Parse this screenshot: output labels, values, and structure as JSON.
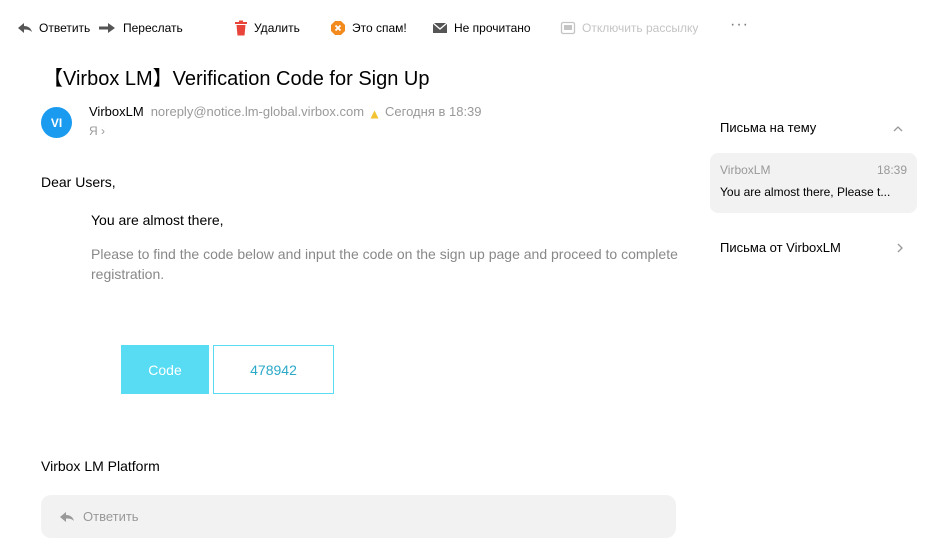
{
  "toolbar": {
    "reply": "Ответить",
    "forward": "Переслать",
    "delete": "Удалить",
    "spam": "Это спам!",
    "unread": "Не прочитано",
    "unsubscribe": "Отключить рассылку",
    "more": "···"
  },
  "email": {
    "subject": "【Virbox LM】Verification Code for Sign Up",
    "avatar_initials": "VI",
    "sender_name": "VirboxLM",
    "sender_email": "noreply@notice.lm-global.virbox.com",
    "date": "Сегодня в 18:39",
    "recipient": "Я ›",
    "greeting": "Dear Users,",
    "almost": "You are almost there,",
    "instructions": "Please to find the code below and input the code on the sign up page and proceed to complete registration.",
    "code_label": "Code",
    "code_value": "478942",
    "platform": "Virbox LM Platform"
  },
  "reply_box": {
    "label": "Ответить"
  },
  "side": {
    "thread_title": "Письма на тему",
    "thread_sender": "VirboxLM",
    "thread_time": "18:39",
    "thread_snippet": "You are almost there, Please t...",
    "from_sender": "Письма от VirboxLM"
  },
  "colors": {
    "accent_code_bg": "#58dcf4",
    "code_text": "#2ba9c7",
    "avatar_bg": "#1a9bf0",
    "delete_icon": "#e8443a",
    "spam_icon": "#f28a1e"
  },
  "icons": {
    "reply": "reply-arrow-icon",
    "forward": "forward-arrow-icon",
    "delete": "trash-icon",
    "spam": "spam-icon",
    "unread": "envelope-icon",
    "unsubscribe": "unsubscribe-icon",
    "sender_mark": "sender-mark-icon",
    "thread_collapse": "chevron-up-icon",
    "from_expand": "chevron-right-icon"
  }
}
